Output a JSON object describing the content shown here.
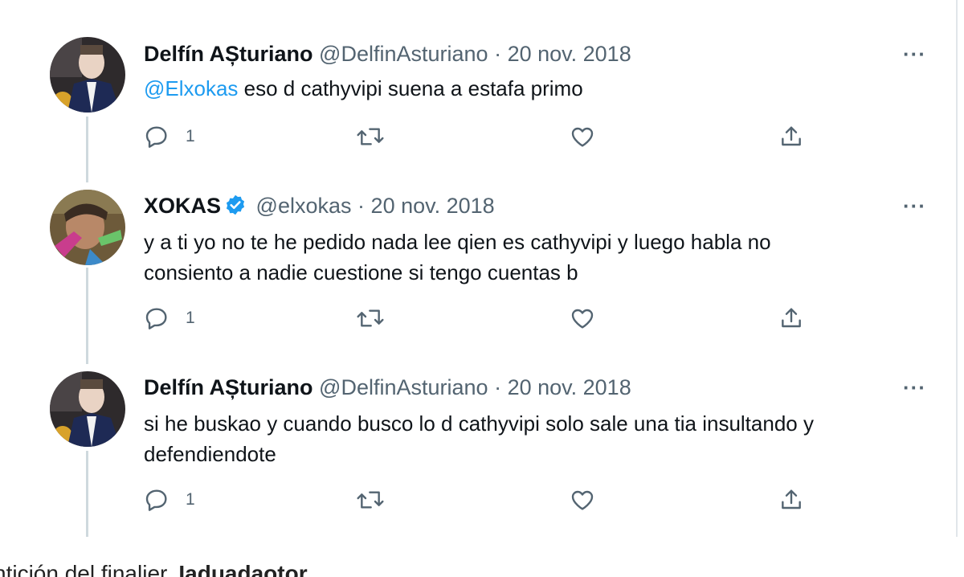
{
  "tweets": [
    {
      "name": "Delfín AȘturiano",
      "handle": "@DelfinAsturiano",
      "separator": "·",
      "date": "20 nov. 2018",
      "verified": false,
      "mention": "@Elxokas",
      "text_after_mention": " eso d cathyvipi suena a estafa primo",
      "reply_count": "1",
      "more": "···"
    },
    {
      "name": "XOKAS",
      "handle": "@elxokas",
      "separator": "·",
      "date": "20 nov. 2018",
      "verified": true,
      "text_line1": "y a ti yo no te he pedido nada lee qien es cathyvipi y luego habla no",
      "text_line2": "consiento a nadie cuestione si tengo cuentas b",
      "reply_count": "1",
      "more": "···"
    },
    {
      "name": "Delfín AȘturiano",
      "handle": "@DelfinAsturiano",
      "separator": "·",
      "date": "20 nov. 2018",
      "verified": false,
      "text_line1": "si he buskao y cuando busco lo d cathyvipi solo sale una tia insultando y",
      "text_line2": "defendiendote",
      "reply_count": "1",
      "more": "···"
    }
  ],
  "icons": [
    "reply-icon",
    "retweet-icon",
    "like-icon",
    "share-icon",
    "more-icon",
    "verified-badge-icon"
  ],
  "colors": {
    "mention": "#1d9bf0",
    "secondary_text": "#536471",
    "verified": "#1d9bf0",
    "thread_line": "#cfd9de"
  },
  "caption": {
    "text_before": "ntición del finalier, ",
    "bold": "Iaduadaotor"
  }
}
